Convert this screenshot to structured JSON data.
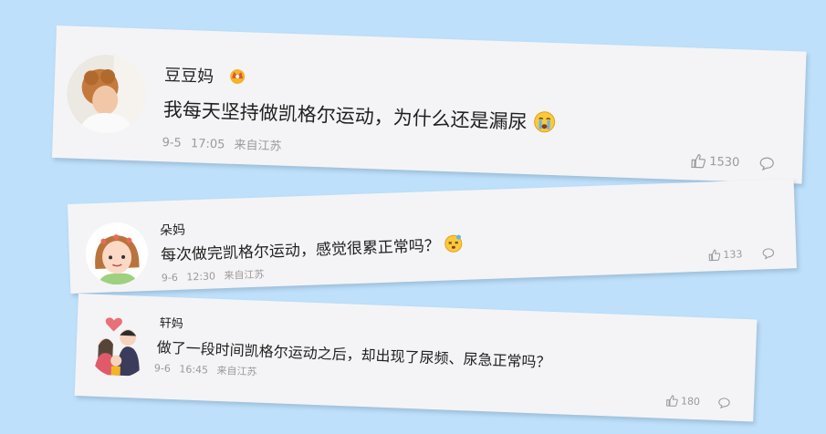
{
  "comments": [
    {
      "username": "豆豆妈",
      "badge_icon": "crown-badge-icon",
      "text": "我每天坚持做凯格尔运动，为什么还是漏尿",
      "emoji": "crying-face-icon",
      "date": "9-5",
      "time": "17:05",
      "location": "来自江苏",
      "likes": "1530",
      "reply_icon": "comment-bubble-icon"
    },
    {
      "username": "朵妈",
      "text": "每次做完凯格尔运动，感觉很累正常吗？",
      "emoji": "dizzy-face-icon",
      "date": "9-6",
      "time": "12:30",
      "location": "来自江苏",
      "likes": "133",
      "reply_icon": "comment-bubble-icon"
    },
    {
      "username": "轩妈",
      "text": "做了一段时间凯格尔运动之后，却出现了尿频、尿急正常吗？",
      "date": "9-6",
      "time": "16:45",
      "location": "来自江苏",
      "likes": "180",
      "reply_icon": "comment-bubble-icon"
    }
  ],
  "colors": {
    "background": "#bfe0fb",
    "card": "#f4f4f6",
    "meta_text": "#9a9a9a"
  }
}
